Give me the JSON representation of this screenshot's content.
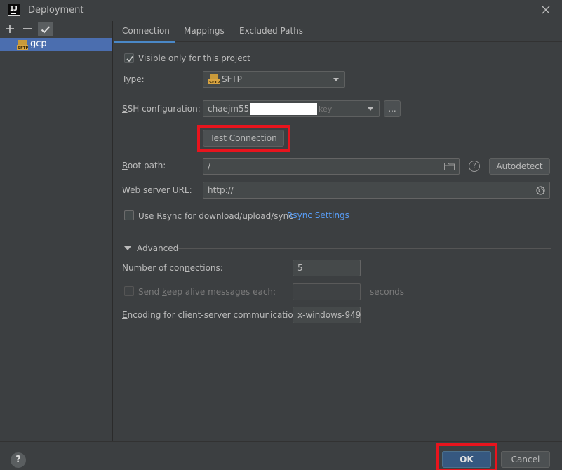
{
  "window": {
    "title": "Deployment"
  },
  "sidebar": {
    "items": [
      {
        "label": "gcp",
        "type_icon": "sftp-icon"
      }
    ]
  },
  "tabs": [
    {
      "label": "Connection",
      "active": true
    },
    {
      "label": "Mappings",
      "active": false
    },
    {
      "label": "Excluded Paths",
      "active": false
    }
  ],
  "connection": {
    "visible_only_label": "Visible only for this project",
    "visible_only_checked": true,
    "type_label_prefix": "",
    "type_label_mn": "T",
    "type_label_rest": "ype:",
    "type_value": "SFTP",
    "ssh_label_mn": "S",
    "ssh_label_rest": "SH configuration:",
    "ssh_value": "chaejm55@",
    "ssh_value_suffix": "key",
    "ssh_more_button": "...",
    "test_connection_pre": "Test ",
    "test_connection_mn": "C",
    "test_connection_post": "onnection",
    "root_path_label_mn": "R",
    "root_path_label_rest": "oot path:",
    "root_path_value": "/",
    "autodetect_button": "Autodetect",
    "web_url_label_mn": "W",
    "web_url_label_rest": "eb server URL:",
    "web_url_value": "http://",
    "rsync_label": "Use Rsync for download/upload/sync",
    "rsync_checked": false,
    "rsync_settings_link": "Rsync Settings"
  },
  "advanced": {
    "title": "Advanced",
    "num_connections_pre": "Number of con",
    "num_connections_mn": "n",
    "num_connections_post": "ections:",
    "num_connections_value": "5",
    "keep_alive_pre": "Send ",
    "keep_alive_mn": "k",
    "keep_alive_post": "eep alive messages each:",
    "keep_alive_value": "",
    "keep_alive_unit": "seconds",
    "encoding_label_mn": "E",
    "encoding_label_rest": "ncoding for client-server communication:",
    "encoding_value": "x-windows-949"
  },
  "footer": {
    "help": "?",
    "ok": "OK",
    "cancel": "Cancel"
  },
  "colors": {
    "background": "#3c3f41",
    "selection": "#4b6eaf",
    "accent_tab": "#4a88c7",
    "link": "#589df6",
    "ok_button": "#365880",
    "highlight": "#e8141d"
  }
}
